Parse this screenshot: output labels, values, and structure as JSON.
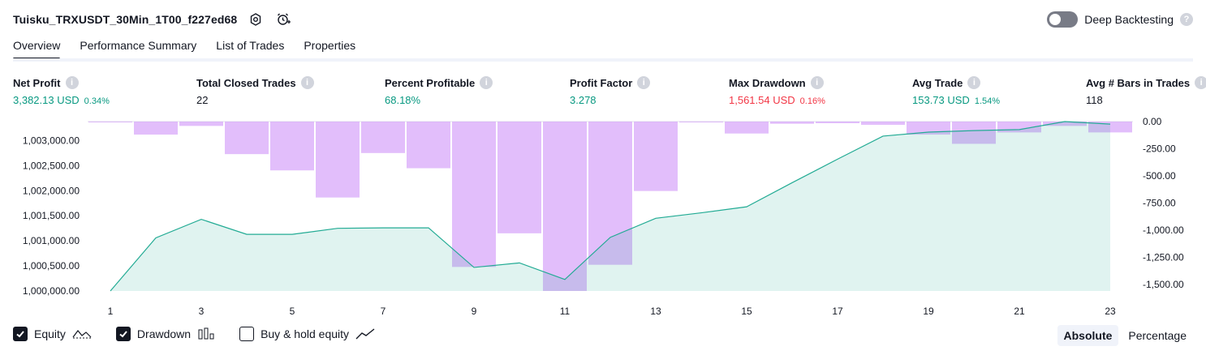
{
  "header": {
    "title": "Tuisku_TRXUSDT_30Min_1T00_f227ed68",
    "settings_icon": "gear-icon",
    "alert_icon": "alarm-clock-plus-icon"
  },
  "deep_backtesting": {
    "label": "Deep Backtesting",
    "enabled": false,
    "help": "?"
  },
  "tabs": [
    {
      "label": "Overview",
      "active": true
    },
    {
      "label": "Performance Summary",
      "active": false
    },
    {
      "label": "List of Trades",
      "active": false
    },
    {
      "label": "Properties",
      "active": false
    }
  ],
  "metrics": [
    {
      "label": "Net Profit",
      "value": "3,382.13 USD",
      "pct": "0.34%",
      "color": "green"
    },
    {
      "label": "Total Closed Trades",
      "value": "22",
      "pct": "",
      "color": "dark"
    },
    {
      "label": "Percent Profitable",
      "value": "68.18%",
      "pct": "",
      "color": "green"
    },
    {
      "label": "Profit Factor",
      "value": "3.278",
      "pct": "",
      "color": "green"
    },
    {
      "label": "Max Drawdown",
      "value": "1,561.54 USD",
      "pct": "0.16%",
      "color": "red"
    },
    {
      "label": "Avg Trade",
      "value": "153.73 USD",
      "pct": "1.54%",
      "color": "green"
    },
    {
      "label": "Avg # Bars in Trades",
      "value": "118",
      "pct": "",
      "color": "dark"
    }
  ],
  "colors": {
    "equity_line": "#22ab94",
    "equity_fill": "#22ab94",
    "drawdown_bar": "#ce93f8",
    "positive": "#089981",
    "negative": "#f23645"
  },
  "chart_data": {
    "type": "line",
    "x_ticks": [
      "1",
      "3",
      "5",
      "7",
      "9",
      "11",
      "13",
      "15",
      "17",
      "19",
      "21",
      "23"
    ],
    "y_left_ticks": [
      "1,003,000.00",
      "1,002,500.00",
      "1,002,000.00",
      "1,001,500.00",
      "1,001,000.00",
      "1,000,500.00",
      "1,000,000.00"
    ],
    "y_right_ticks": [
      "0.00",
      "-250.00",
      "-500.00",
      "-750.00",
      "-1,000.00",
      "-1,250.00",
      "-1,500.00"
    ],
    "ylim_left": [
      1000000,
      1003380
    ],
    "ylim_right": [
      -1561.54,
      0
    ],
    "series": [
      {
        "name": "Equity",
        "type": "area",
        "x": [
          1,
          2,
          3,
          4,
          5,
          6,
          7,
          8,
          9,
          10,
          11,
          12,
          13,
          14,
          15,
          16,
          17,
          18,
          19,
          20,
          21,
          22,
          23
        ],
        "values": [
          1000000,
          1001060,
          1001430,
          1001130,
          1001130,
          1001250,
          1001260,
          1001260,
          1000470,
          1000560,
          1000230,
          1001070,
          1001450,
          1001560,
          1001680,
          1002160,
          1002630,
          1003090,
          1003170,
          1003200,
          1003220,
          1003380,
          1003330
        ]
      },
      {
        "name": "Drawdown",
        "type": "bar",
        "x": [
          1,
          2,
          3,
          4,
          5,
          6,
          7,
          8,
          9,
          10,
          11,
          12,
          13,
          14,
          15,
          16,
          17,
          18,
          19,
          20,
          21,
          22,
          23
        ],
        "values": [
          -5,
          -120,
          -40,
          -300,
          -450,
          -700,
          -290,
          -430,
          -1340,
          -1030,
          -1561.54,
          -1320,
          -640,
          -5,
          -110,
          -20,
          -15,
          -30,
          -120,
          -205,
          -100,
          -40,
          -100
        ]
      }
    ]
  },
  "legend": [
    {
      "label": "Equity",
      "checked": true,
      "icon": "equity-line-icon"
    },
    {
      "label": "Drawdown",
      "checked": true,
      "icon": "drawdown-bars-icon"
    },
    {
      "label": "Buy & hold equity",
      "checked": false,
      "icon": "trend-line-icon"
    }
  ],
  "modes": [
    {
      "label": "Absolute",
      "active": true
    },
    {
      "label": "Percentage",
      "active": false
    }
  ]
}
